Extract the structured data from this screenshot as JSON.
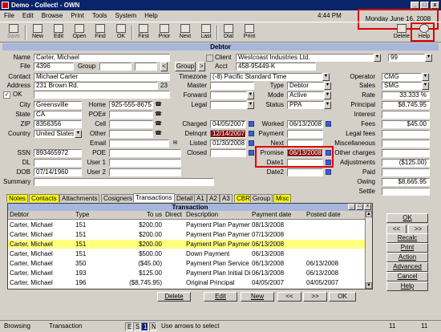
{
  "window": {
    "title": "Demo - Collect! - OWN",
    "clock": "4:44 PM",
    "date": "Monday June 16, 2008",
    "min": "_",
    "max": "□",
    "close": "x"
  },
  "menu": [
    "File",
    "Edit",
    "Browse",
    "Print",
    "Tools",
    "System",
    "Help"
  ],
  "toolbar": {
    "left": [
      "Save",
      "New",
      "Edit",
      "Open",
      "Find",
      "OK",
      "First",
      "Prior",
      "Next",
      "Last",
      "Dial",
      "Print"
    ],
    "right": [
      "Delete",
      "Help"
    ]
  },
  "debtor": {
    "section_title": "Debtor",
    "name_label": "Name",
    "name": "Carter, Michael",
    "file_label": "File",
    "file": "4396",
    "group_label": "Group",
    "group_btn": "Group",
    "lt": "<",
    "gt": ">",
    "client_label": "Client",
    "client": "Westcoast Industries Ltd.",
    "client_num": "99",
    "acct_label": "Acct",
    "acct": "458-95449-K",
    "contact_label": "Contact",
    "contact": "Michael Carter",
    "timezone_label": "Timezone",
    "timezone": "(-8) Pacific Standard Time",
    "operator_label": "Operator",
    "operator": "CMG",
    "address_label": "Address",
    "address": "231 Brown Rd.",
    "address_num": "23",
    "master_label": "Master",
    "type_label": "Type",
    "type": "Debtor",
    "sales_label": "Sales",
    "sales": "SMG",
    "ok_label": "OK",
    "forward_label": "Forward",
    "mode_label": "Mode",
    "mode": "Active",
    "rate_label": "Rate",
    "rate": "33.333 %",
    "city_label": "City",
    "city": "Greensville",
    "home_label": "Home",
    "home": "925-555-8675",
    "legal_label": "Legal",
    "status_label": "Status",
    "status": "PPA",
    "principal_label": "Principal",
    "principal": "$8,745.95",
    "state_label": "State",
    "state": "CA",
    "poe_hash_label": "POE#",
    "interest_label": "Interest",
    "zip_label": "ZIP",
    "zip": "8356356",
    "cell_label": "Cell",
    "charged_label": "Charged",
    "charged": "04/05/2007",
    "worked_label": "Worked",
    "worked": "06/13/2008",
    "fees_label": "Fees",
    "fees": "$45.00",
    "country_label": "Country",
    "country": "United States",
    "other_label": "Other",
    "delnqnt_label": "Delnqnt",
    "delnqnt": "12/14/2007",
    "payment_label": "Payment",
    "legal_fees_label": "Legal fees",
    "email_label": "Email",
    "listed_label": "Listed",
    "listed": "01/30/2008",
    "next_label": "Next",
    "misc_label": "Miscellaneous",
    "ssn_label": "SSN",
    "ssn": "893465972",
    "poe_label": "POE",
    "closed_label": "Closed",
    "promise_label": "Promise",
    "promise": "06/13/2008",
    "other_charges_label": "Other charges",
    "dl_label": "DL",
    "user1_label": "User 1",
    "date1_label": "Date1",
    "adjustments_label": "Adjustments",
    "adjustments": "($125.00)",
    "dob_label": "DOB",
    "dob": "07/14/1960",
    "user2_label": "User 2",
    "date2_label": "Date2",
    "paid_label": "Paid",
    "summary_label": "Summary",
    "owing_label": "Owing",
    "owing": "$8,665.95",
    "settle_label": "Settle"
  },
  "tabs": [
    "Notes",
    "Contacts",
    "Attachments",
    "Cosigners",
    "Transactions",
    "Detail",
    "A1",
    "A2",
    "A3",
    "CBR",
    "Group",
    "Misc"
  ],
  "transactions": {
    "title": "Transaction",
    "columns": [
      "Debtor",
      "Type",
      "To us",
      "Direct",
      "Description",
      "Payment date",
      "Posted date"
    ],
    "rows": [
      {
        "debtor": "Carter, Michael",
        "type": "151",
        "to_us": "$200.00",
        "direct": "",
        "desc": "Payment Plan Payment",
        "pay": "08/13/2008",
        "posted": ""
      },
      {
        "debtor": "Carter, Michael",
        "type": "151",
        "to_us": "$200.00",
        "direct": "",
        "desc": "Payment Plan Payment",
        "pay": "07/13/2008",
        "posted": ""
      },
      {
        "debtor": "Carter, Michael",
        "type": "151",
        "to_us": "$200.00",
        "direct": "",
        "desc": "Payment Plan Payment",
        "pay": "06/13/2008",
        "posted": ""
      },
      {
        "debtor": "Carter, Michael",
        "type": "151",
        "to_us": "$500.00",
        "direct": "",
        "desc": "Down Payment",
        "pay": "06/13/2008",
        "posted": ""
      },
      {
        "debtor": "Carter, Michael",
        "type": "350",
        "to_us": "($45.00)",
        "direct": "",
        "desc": "Payment Plan Service Cl",
        "pay": "06/13/2008",
        "posted": "06/13/2008"
      },
      {
        "debtor": "Carter, Michael",
        "type": "193",
        "to_us": "$125.00",
        "direct": "",
        "desc": "Payment Plan Initial Disc",
        "pay": "06/13/2008",
        "posted": "06/13/2008"
      },
      {
        "debtor": "Carter, Michael",
        "type": "196",
        "to_us": "($8,745.95)",
        "direct": "",
        "desc": "Original Principal",
        "pay": "04/05/2007",
        "posted": "04/05/2007"
      }
    ],
    "buttons": {
      "delete": "Delete",
      "edit": "Edit",
      "new": "New",
      "prev": "<<",
      "next": ">>",
      "ok": "OK"
    }
  },
  "side_buttons": {
    "ok": "OK",
    "prev": "<<",
    "next": ">>",
    "recalc": "Recalc",
    "print": "Print",
    "action": "Action",
    "advanced": "Advanced",
    "cancel": "Cancel",
    "help": "Help"
  },
  "status": {
    "mode": "Browsing",
    "screen": "Transaction",
    "flags": [
      "E",
      "S",
      "1",
      "N"
    ],
    "hint": "Use arrows to select",
    "c1": "11",
    "c2": "11"
  }
}
